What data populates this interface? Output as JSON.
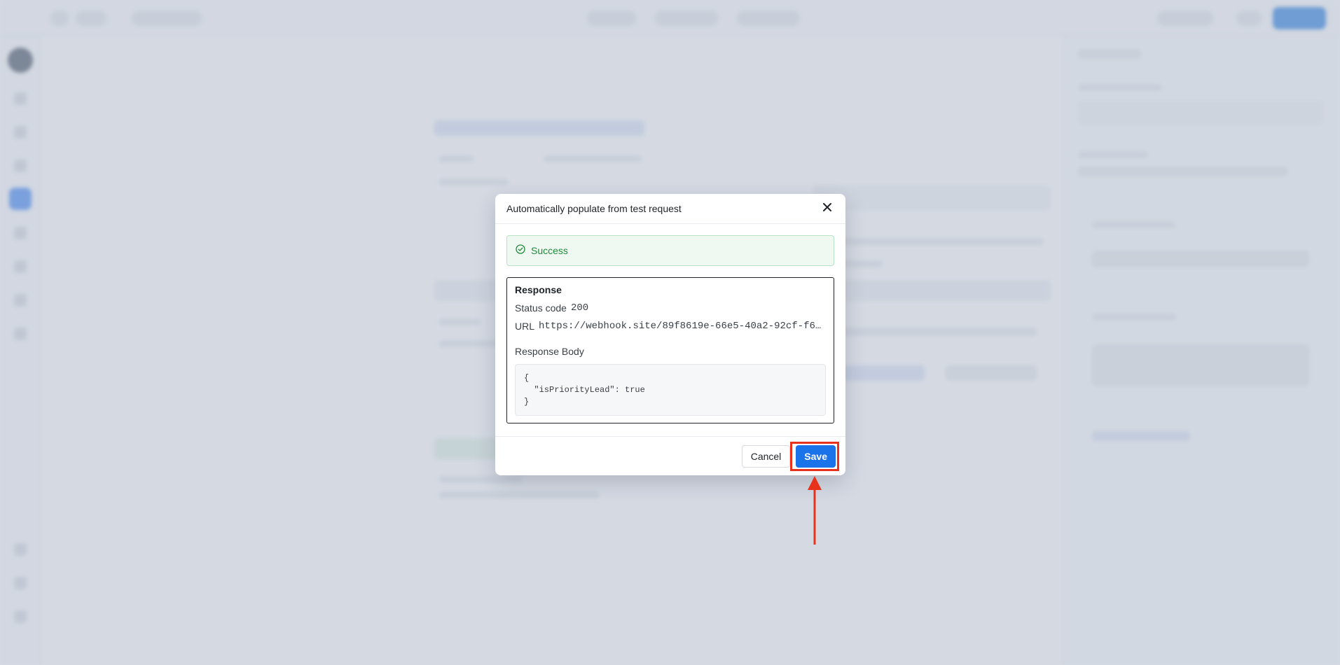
{
  "modal": {
    "title": "Automatically populate from test request",
    "success_text": "Success",
    "response": {
      "heading": "Response",
      "status_label": "Status code",
      "status_value": "200",
      "url_label": "URL",
      "url_value": "https://webhook.site/89f8619e-66e5-40a2-92cf-f6…",
      "body_label": "Response Body",
      "body_text": "{\n  \"isPriorityLead\": true\n}"
    },
    "cancel_label": "Cancel",
    "save_label": "Save"
  },
  "icons": {
    "close": "close-icon",
    "success": "check-circle-icon",
    "arrow": "arrow-up-icon"
  },
  "colors": {
    "primary": "#1a73e8",
    "success": "#1f8a3b",
    "annotation": "#e8321c"
  }
}
